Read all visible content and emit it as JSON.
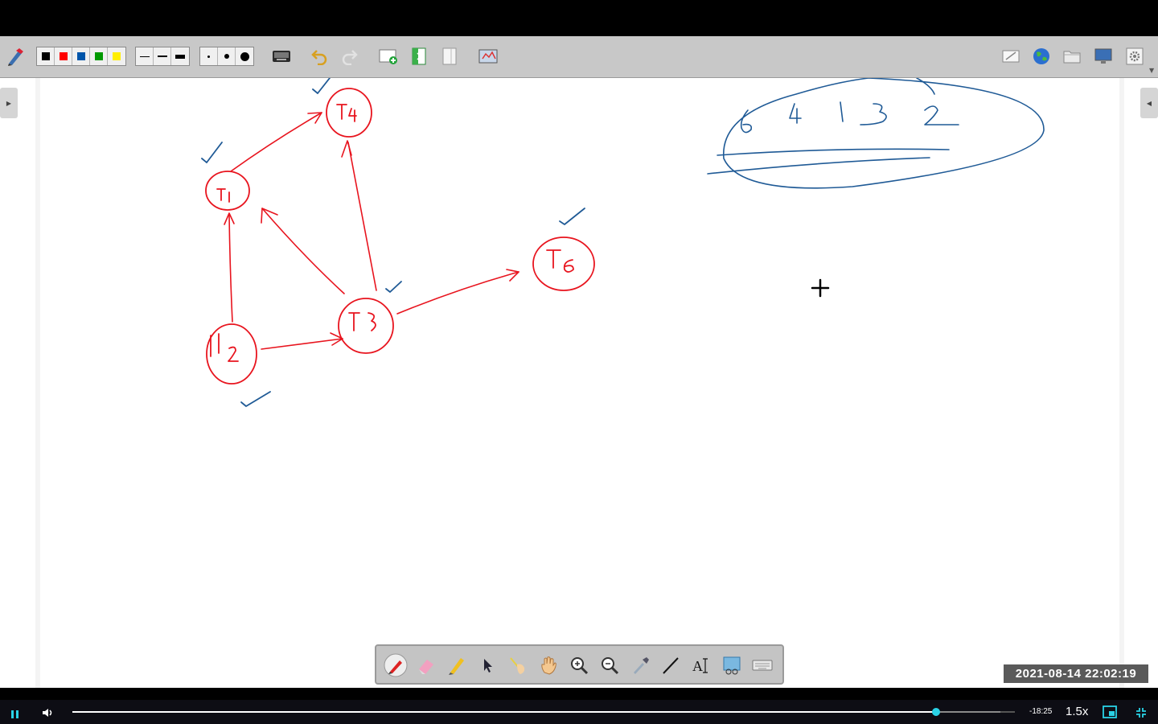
{
  "toolbar": {
    "colors": [
      "#000000",
      "#ff0000",
      "#0055aa",
      "#009900",
      "#ffee00"
    ],
    "line_widths": [
      "thin",
      "medium",
      "thick"
    ],
    "dot_sizes": [
      "small",
      "medium",
      "large"
    ],
    "left_icons": [
      "keyboard-icon",
      "undo-icon",
      "redo-icon",
      "new-page-icon",
      "page-icon",
      "blank-page-icon",
      "screenshot-icon"
    ],
    "right_icons": [
      "whiteboard-icon",
      "globe-icon",
      "folder-icon",
      "screen-icon",
      "settings-icon"
    ]
  },
  "whiteboard": {
    "nodes": [
      {
        "id": "T1",
        "label": "T1"
      },
      {
        "id": "T2",
        "label": "T2"
      },
      {
        "id": "T3",
        "label": "T3"
      },
      {
        "id": "T4",
        "label": "T4"
      },
      {
        "id": "T6",
        "label": "T6"
      }
    ],
    "edges": [
      [
        "T1",
        "T4"
      ],
      [
        "T2",
        "T1"
      ],
      [
        "T2",
        "T3"
      ],
      [
        "T3",
        "T1"
      ],
      [
        "T3",
        "T4"
      ],
      [
        "T3",
        "T6"
      ]
    ],
    "order": [
      "6",
      "4",
      "1",
      "3",
      "2"
    ],
    "ink_colors": {
      "graph": "#e8141e",
      "marks": "#1f5a96"
    }
  },
  "drawing_tools": [
    "pen-icon",
    "eraser-icon",
    "highlighter-icon",
    "select-arrow-icon",
    "laser-pointer-icon",
    "hand-pan-icon",
    "zoom-in-icon",
    "zoom-out-icon",
    "color-picker-icon",
    "line-icon",
    "text-icon",
    "screen-capture-icon",
    "keyboard-icon"
  ],
  "recording": {
    "timestamp": "2021-08-14  22:02:19"
  },
  "player": {
    "time_remaining": "-18:25",
    "speed": "1.5x",
    "progress": 0.916,
    "buffered": 0.985,
    "accent": "#2ad2e6"
  }
}
